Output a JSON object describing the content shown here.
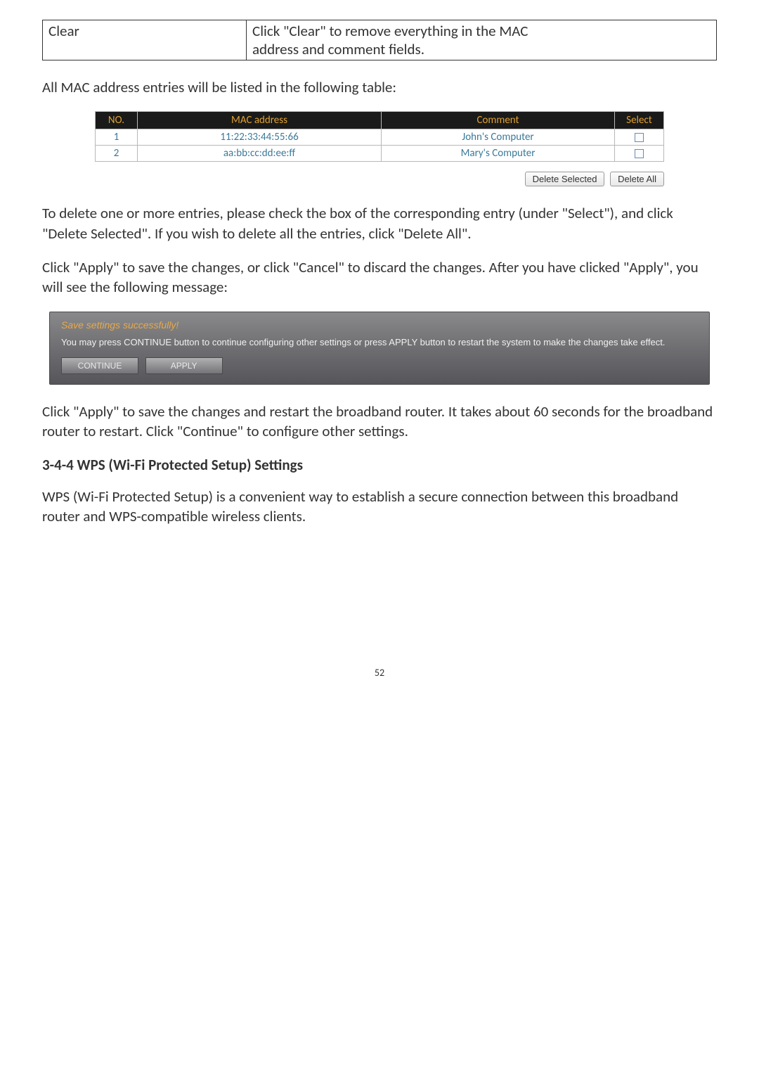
{
  "info_table": {
    "label": "Clear",
    "desc_line1": "Click \"Clear\" to remove everything in the MAC",
    "desc_line2": "address and comment fields."
  },
  "para1": "All MAC address entries will be listed in the following table:",
  "mac_table": {
    "headers": {
      "no": "NO.",
      "mac": "MAC address",
      "comment": "Comment",
      "select": "Select"
    },
    "rows": [
      {
        "no": "1",
        "mac": "11:22:33:44:55:66",
        "comment": "John's Computer"
      },
      {
        "no": "2",
        "mac": "aa:bb:cc:dd:ee:ff",
        "comment": "Mary's Computer"
      }
    ],
    "delete_selected": "Delete Selected",
    "delete_all": "Delete All"
  },
  "para2": "To delete one or more entries, please check the box of the corresponding entry (under \"Select\"), and click \"Delete Selected\". If you wish to delete all the entries, click \"Delete All\".",
  "para3": "Click \"Apply\" to save the changes, or click \"Cancel\" to discard the changes. After you have clicked \"Apply\", you will see the following message:",
  "save_panel": {
    "title": "Save settings successfully!",
    "body": "You may press CONTINUE button to continue configuring other settings or press APPLY button to restart the system to make the changes take effect.",
    "continue": "CONTINUE",
    "apply": "APPLY"
  },
  "para4": "Click \"Apply\" to save the changes and restart the broadband router. It takes about 60 seconds for the broadband router to restart. Click \"Continue\" to configure other settings.",
  "section_heading": "3-4-4 WPS (Wi-Fi Protected Setup) Settings",
  "para5": "WPS (Wi-Fi Protected Setup) is a convenient way to establish a secure connection between this broadband router and WPS-compatible wireless clients.",
  "page_number": "52"
}
